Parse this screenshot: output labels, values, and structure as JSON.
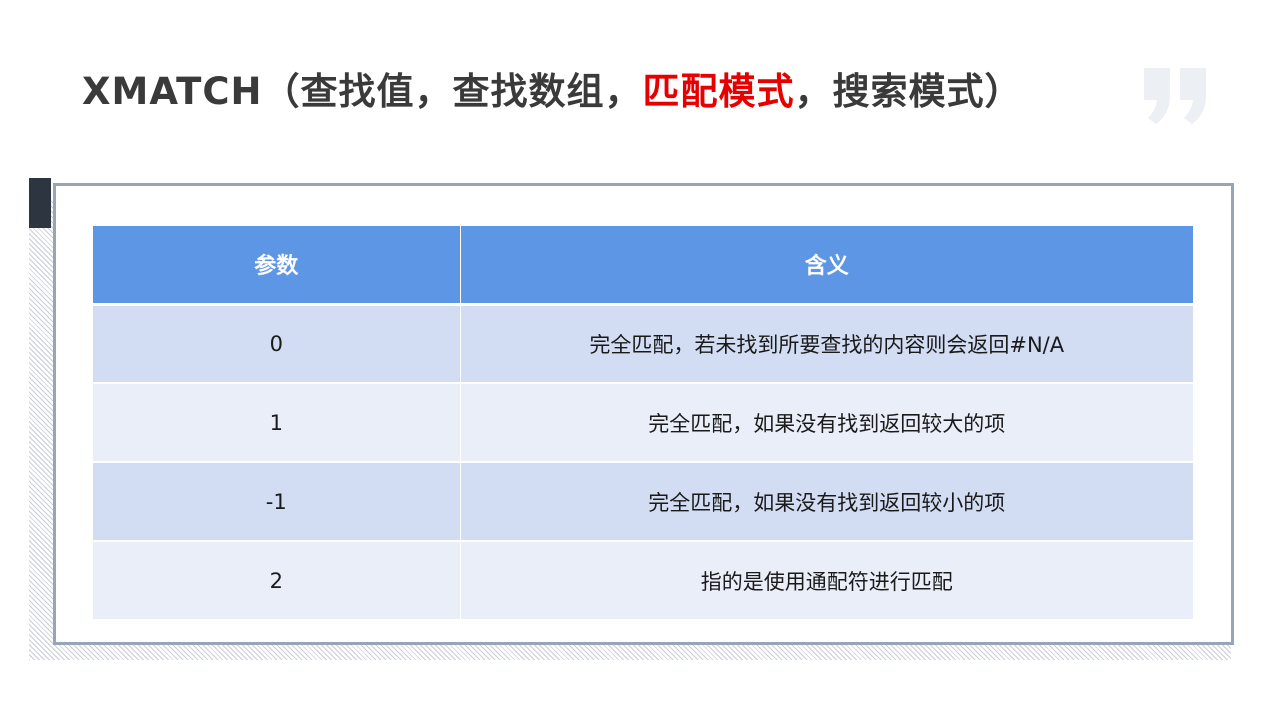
{
  "title": {
    "prefix": "XMATCH（查找值，查找数组，",
    "highlight": "匹配模式",
    "suffix": "，搜索模式）",
    "highlight_color": "#e60000"
  },
  "decoration": {
    "icon": "quote-icon"
  },
  "table": {
    "headers": [
      "参数",
      "含义"
    ],
    "rows": [
      [
        "0",
        "完全匹配，若未找到所要查找的内容则会返回#N/A"
      ],
      [
        "1",
        "完全匹配，如果没有找到返回较大的项"
      ],
      [
        "-1",
        "完全匹配，如果没有找到返回较小的项"
      ],
      [
        "2",
        "指的是使用通配符进行匹配"
      ]
    ],
    "header_color": "#5e96e6"
  }
}
